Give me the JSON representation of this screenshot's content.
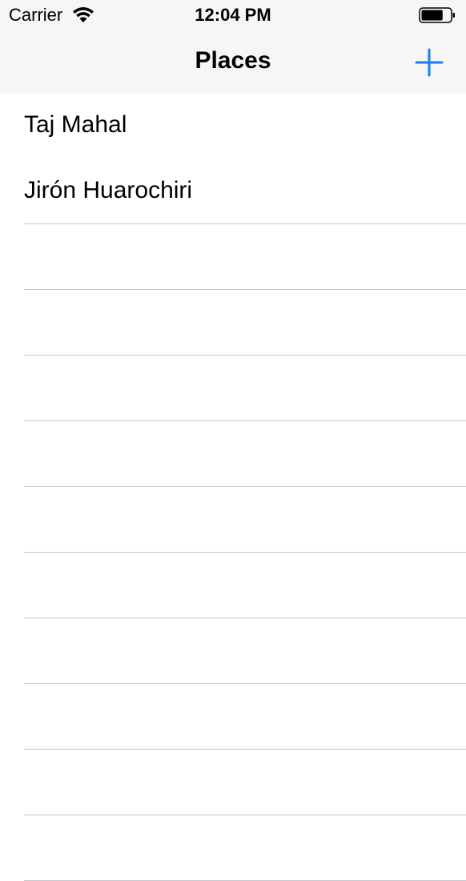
{
  "status_bar": {
    "carrier": "Carrier",
    "time": "12:04 PM",
    "wifi_icon": "wifi-icon",
    "battery_icon": "battery-icon",
    "battery_level": 0.75
  },
  "nav_bar": {
    "title": "Places",
    "add_icon": "plus-icon",
    "accent_color": "#147efb"
  },
  "places": [
    {
      "label": "Taj Mahal"
    },
    {
      "label": "Jirón Huarochiri"
    }
  ],
  "colors": {
    "bar_background": "#f6f6f6",
    "separator": "#c8c7cc",
    "list_background": "#ffffff"
  }
}
